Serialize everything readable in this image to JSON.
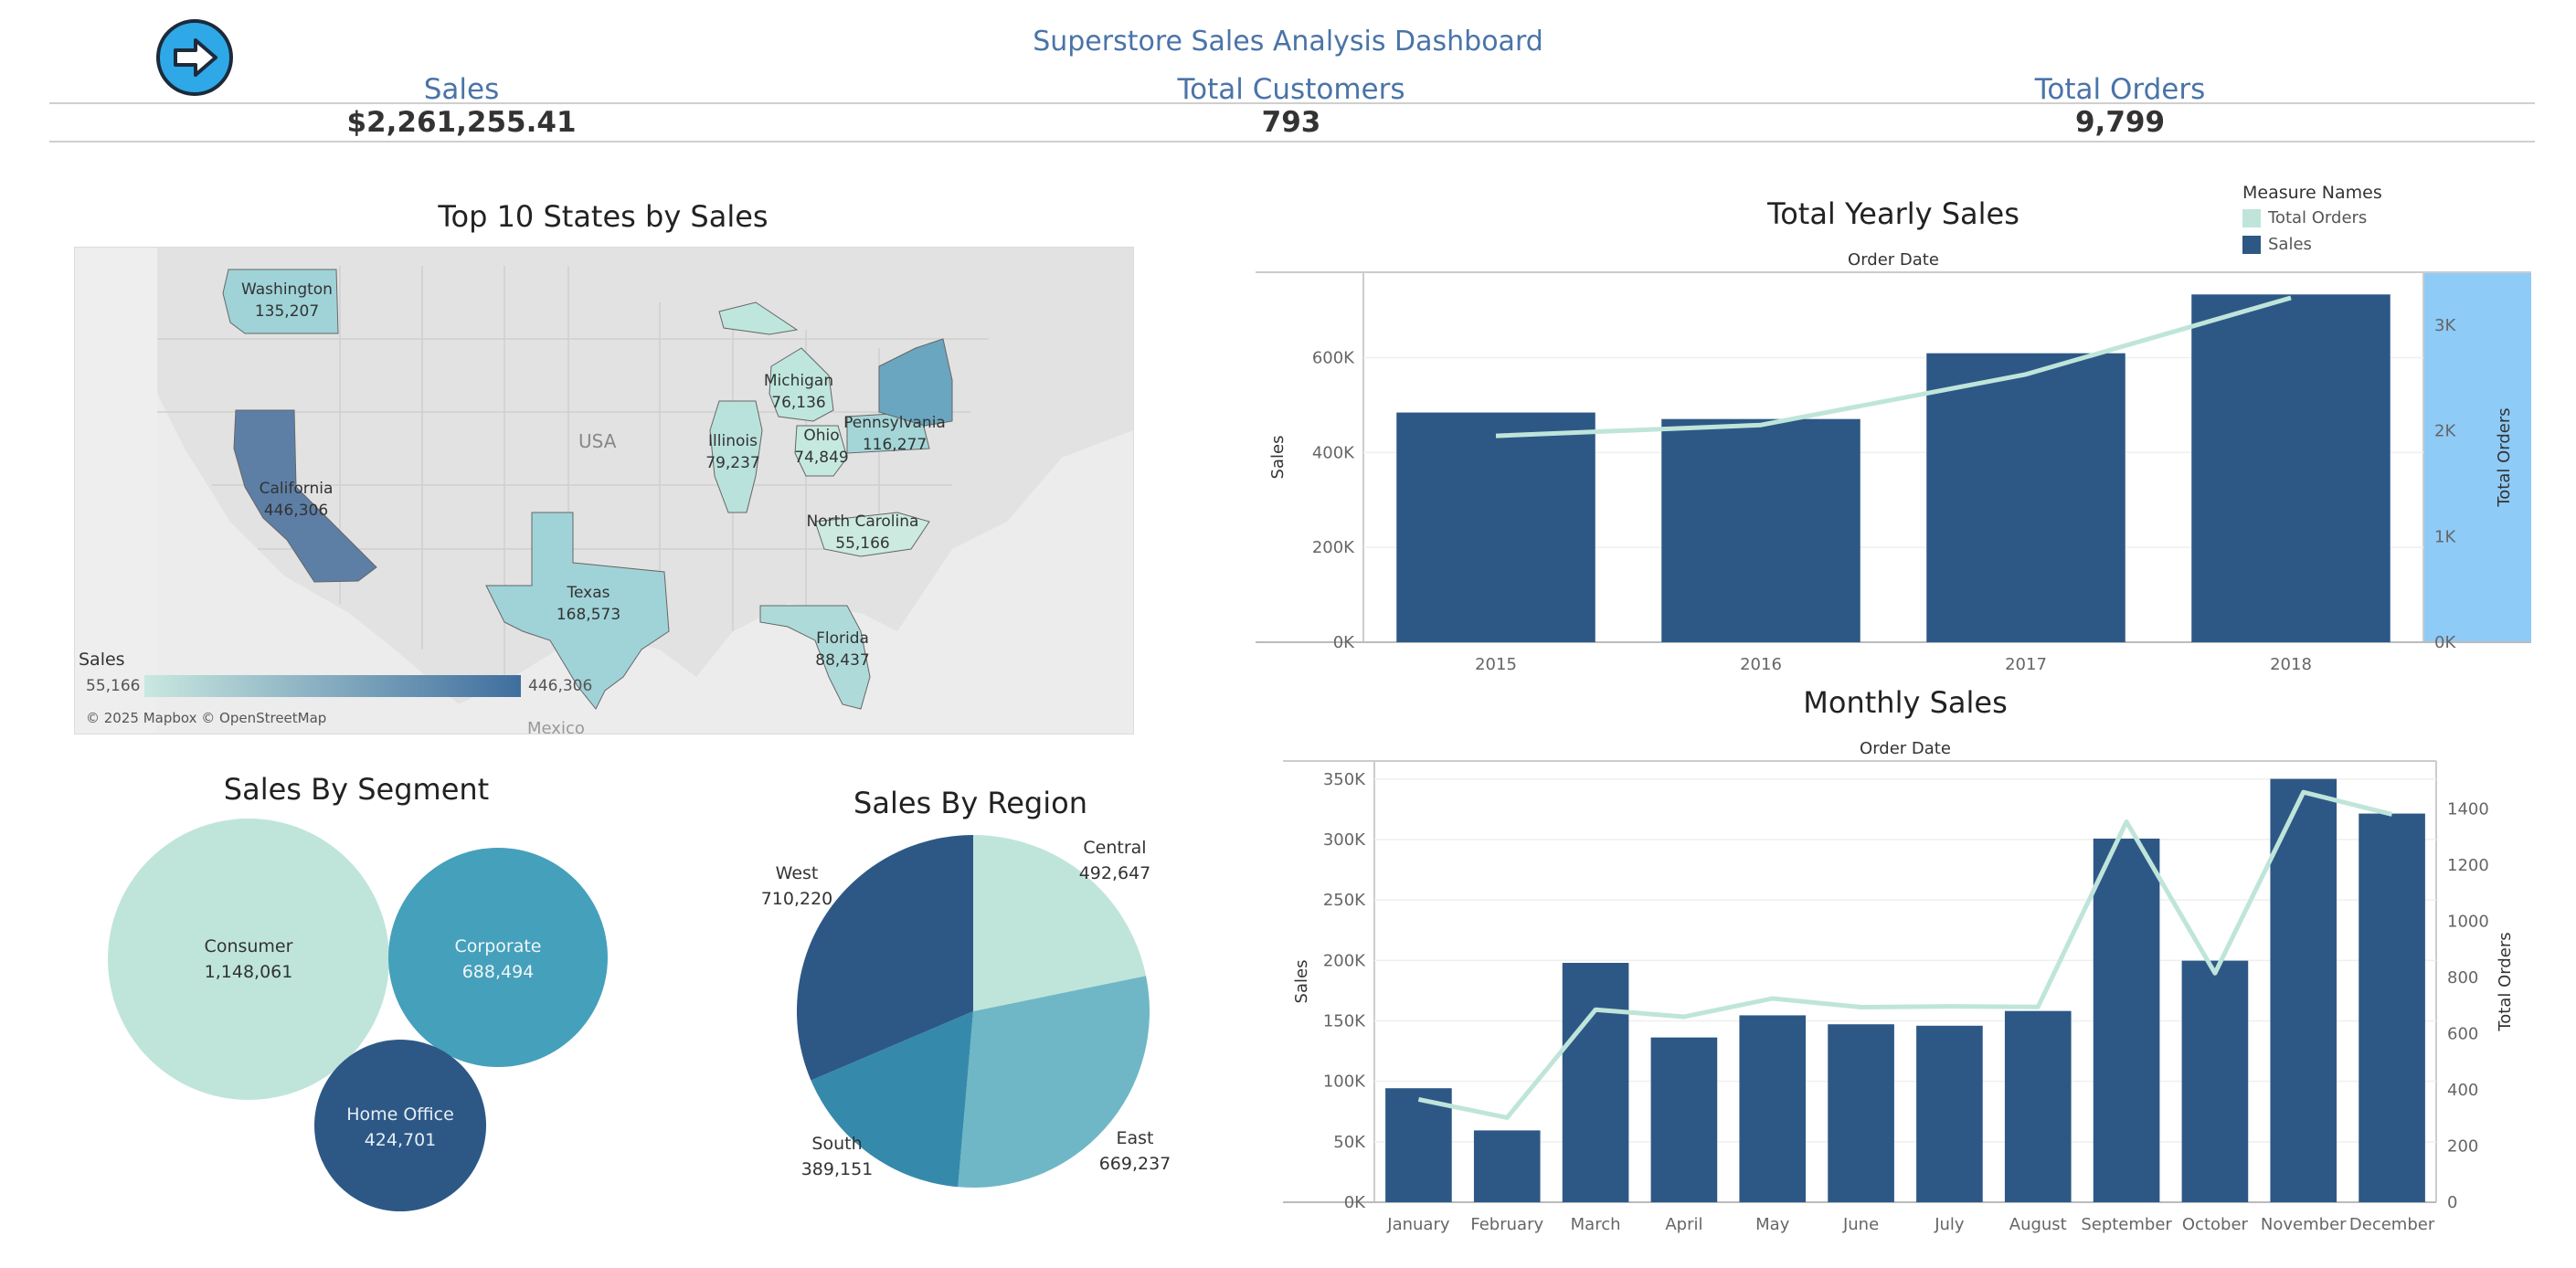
{
  "dashboard": {
    "title": "Superstore Sales Analysis Dashboard",
    "nav_icon": "arrow-right-icon"
  },
  "kpis": [
    {
      "label": "Sales",
      "value": "$2,261,255.41"
    },
    {
      "label": "Total Customers",
      "value": "793"
    },
    {
      "label": "Total Orders",
      "value": "9,799"
    }
  ],
  "map": {
    "title": "Top 10 States by Sales",
    "country_label": "USA",
    "neighbor_label": "Mexico",
    "credit": "© 2025 Mapbox © OpenStreetMap",
    "legend_title": "Sales",
    "legend_min": "55,166",
    "legend_max": "446,306",
    "color_low": "#c9e8e0",
    "color_high": "#3f6e9e",
    "states": [
      {
        "name": "Washington",
        "value": "135,207"
      },
      {
        "name": "California",
        "value": "446,306"
      },
      {
        "name": "Texas",
        "value": "168,573"
      },
      {
        "name": "Illinois",
        "value": "79,237"
      },
      {
        "name": "Michigan",
        "value": "76,136"
      },
      {
        "name": "Ohio",
        "value": "74,849"
      },
      {
        "name": "Pennsylvania",
        "value": "116,277"
      },
      {
        "name": "North Carolina",
        "value": "55,166"
      },
      {
        "name": "Florida",
        "value": "88,437"
      }
    ]
  },
  "segment": {
    "title": "Sales By Segment",
    "items": [
      {
        "name": "Consumer",
        "value": "1,148,061"
      },
      {
        "name": "Corporate",
        "value": "688,494"
      },
      {
        "name": "Home Office",
        "value": "424,701"
      }
    ]
  },
  "region": {
    "title": "Sales By Region",
    "items": [
      {
        "name": "Central",
        "value": "492,647"
      },
      {
        "name": "East",
        "value": "669,237"
      },
      {
        "name": "South",
        "value": "389,151"
      },
      {
        "name": "West",
        "value": "710,220"
      }
    ]
  },
  "legend": {
    "title": "Measure Names",
    "items": [
      {
        "name": "Total Orders",
        "color": "#bfe5da"
      },
      {
        "name": "Sales",
        "color": "#2d5886"
      }
    ]
  },
  "colors": {
    "bar": "#2d5886",
    "line": "#bfe5da",
    "accent_band": "#8ecbf7",
    "title": "#4a74a8"
  },
  "chart_data": [
    {
      "type": "bar",
      "title": "Total Yearly Sales",
      "xlabel": "Order Date",
      "ylabel": "Sales",
      "y2label": "Total Orders",
      "categories": [
        "2015",
        "2016",
        "2017",
        "2018"
      ],
      "series": [
        {
          "name": "Sales",
          "values": [
            484247,
            470533,
            609206,
            733215
          ]
        },
        {
          "name": "Total Orders",
          "values": [
            1952,
            2055,
            2534,
            3258
          ],
          "axis": "right"
        }
      ],
      "ylim": [
        0,
        780000
      ],
      "y2lim": [
        0,
        3500
      ],
      "yticks": [
        "0K",
        "200K",
        "400K",
        "600K"
      ],
      "y2ticks": [
        "0K",
        "1K",
        "2K",
        "3K"
      ]
    },
    {
      "type": "bar",
      "title": "Monthly Sales",
      "xlabel": "Order Date",
      "ylabel": "Sales",
      "y2label": "Total Orders",
      "categories": [
        "January",
        "February",
        "March",
        "April",
        "May",
        "June",
        "July",
        "August",
        "September",
        "October",
        "November",
        "December"
      ],
      "series": [
        {
          "name": "Sales",
          "values": [
            94300,
            59400,
            198000,
            136300,
            154600,
            147200,
            146000,
            158200,
            300800,
            199800,
            350200,
            321500
          ]
        },
        {
          "name": "Total Orders",
          "values": [
            366,
            301,
            685,
            660,
            725,
            694,
            697,
            695,
            1354,
            815,
            1459,
            1380
          ],
          "axis": "right"
        }
      ],
      "ylim": [
        0,
        365000
      ],
      "y2lim": [
        0,
        1570
      ],
      "yticks": [
        "0K",
        "50K",
        "100K",
        "150K",
        "200K",
        "250K",
        "300K",
        "350K"
      ],
      "y2ticks": [
        "0",
        "200",
        "400",
        "600",
        "800",
        "1000",
        "1200",
        "1400"
      ]
    }
  ]
}
